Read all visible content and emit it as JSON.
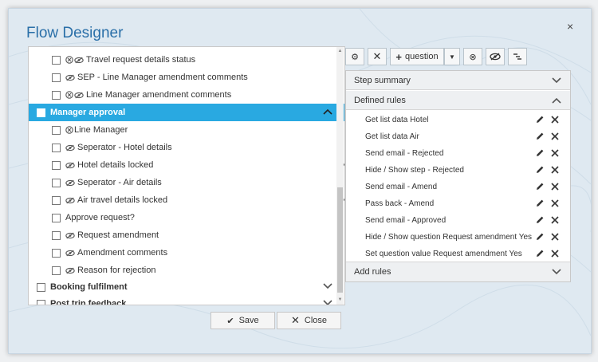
{
  "dialog": {
    "title": "Flow Designer",
    "close_label": "×"
  },
  "tree": {
    "items": [
      {
        "label": "Travel request details status",
        "icons": "⊗👁",
        "selected": false,
        "chevron": false
      },
      {
        "label": "SEP - Line Manager amendment comments",
        "icons": "👁",
        "selected": false,
        "chevron": false
      },
      {
        "label": "Line Manager amendment comments",
        "icons": "⊗👁",
        "selected": false,
        "chevron": false
      },
      {
        "label": "Manager approval",
        "icons": "",
        "selected": true,
        "chevron": "up"
      },
      {
        "label": "Line Manager",
        "icons": "⊗",
        "selected": false,
        "chevron": false
      },
      {
        "label": "Seperator - Hotel details",
        "icons": "👁",
        "selected": false,
        "chevron": false
      },
      {
        "label": "Hotel details locked",
        "icons": "👁",
        "selected": false,
        "chevron": "down"
      },
      {
        "label": "Seperator - Air details",
        "icons": "👁",
        "selected": false,
        "chevron": false
      },
      {
        "label": "Air travel details locked",
        "icons": "👁",
        "selected": false,
        "chevron": "down"
      },
      {
        "label": "Approve request?",
        "icons": "",
        "selected": false,
        "chevron": false
      },
      {
        "label": "Request amendment",
        "icons": "👁",
        "selected": false,
        "chevron": false
      },
      {
        "label": "Amendment comments",
        "icons": "👁",
        "selected": false,
        "chevron": false
      },
      {
        "label": "Reason for rejection",
        "icons": "👁",
        "selected": false,
        "chevron": false
      },
      {
        "label": "Booking fulfilment",
        "icons": "",
        "selected": false,
        "chevron": "down",
        "bold": true
      },
      {
        "label": "Post trip feedback",
        "icons": "",
        "selected": false,
        "chevron": "down",
        "bold": true
      }
    ]
  },
  "buttons": {
    "save": "Save",
    "close": "Close"
  },
  "toolbar": {
    "question_label": "question"
  },
  "panel": {
    "step_summary": "Step summary",
    "defined_rules": "Defined rules",
    "add_rules": "Add rules",
    "rules": [
      "Get list data Hotel",
      "Get list data Air",
      "Send email - Rejected",
      "Hide / Show step - Rejected",
      "Send email - Amend",
      "Pass back - Amend",
      "Send email - Approved",
      "Hide / Show question Request amendment Yes",
      "Set question value Request amendment Yes"
    ]
  },
  "colors": {
    "accent": "#29a9e1",
    "title": "#2a6fa8"
  }
}
